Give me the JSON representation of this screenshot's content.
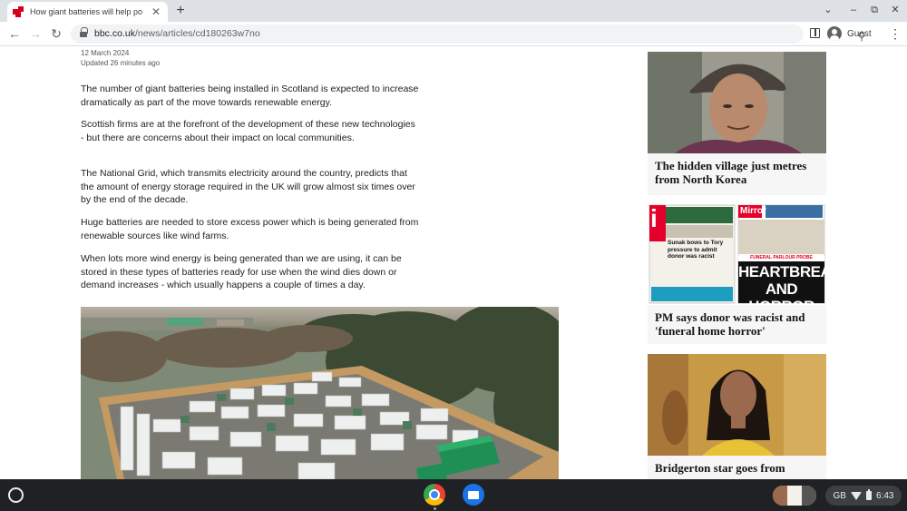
{
  "browser": {
    "tab_title": "How giant batteries will help po",
    "tab_close": "✕",
    "new_tab": "+",
    "url_domain": "bbc.co.uk",
    "url_path": "/news/articles/cd180263w7no",
    "profile_name": "Guest",
    "window_controls": {
      "chevron": "⌄",
      "minimize": "–",
      "restore": "⧉",
      "close": "✕"
    }
  },
  "article": {
    "date": "12 March 2024",
    "updated": "Updated 26 minutes ago",
    "paragraphs": [
      "The number of giant batteries being installed in Scotland is expected to increase dramatically as part of the move towards renewable energy.",
      "Scottish firms are at the forefront of the development of these new technologies - but there are concerns about their impact on local communities.",
      "The National Grid, which transmits electricity around the country, predicts that the amount of energy storage required in the UK will grow almost six times over by the end of the decade.",
      "Huge batteries are needed to store excess power which is being generated from renewable sources like wind farms.",
      "When lots more wind energy is being generated than we are using, it can be stored in these types of batteries ready for use when the wind dies down or demand increases - which usually happens a couple of times a day."
    ]
  },
  "sidebar": {
    "cards": [
      {
        "title": "The hidden village just metres from North Korea"
      },
      {
        "title": "PM says donor was racist and 'funeral home horror'"
      },
      {
        "title": "Bridgerton star goes from"
      }
    ],
    "newspaper_text": {
      "i_logo": "i",
      "i_headline": "Sunak bows to Tory pressure to admit donor was racist",
      "mirror_logo": "Mirror",
      "mirror_kicker": "FUNERAL PARLOUR PROBE",
      "mirror_headline_1": "HEARTBREAK",
      "mirror_headline_2": "AND HORROR"
    }
  },
  "shelf": {
    "region": "GB",
    "time": "6:43"
  },
  "colors": {
    "bbc_red": "#d6001c",
    "tabbar": "#dee1e6",
    "shelf": "#202124",
    "card_bg": "#f6f6f6"
  }
}
